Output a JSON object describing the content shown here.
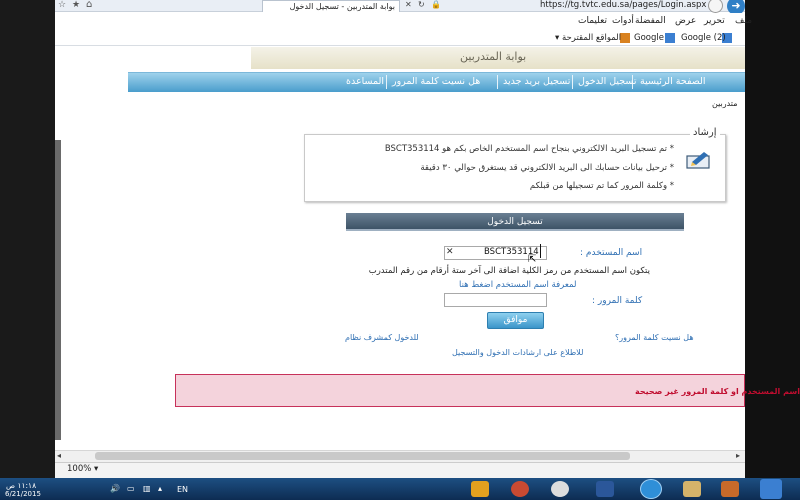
{
  "browser": {
    "tab_title": "بوابة المتدربين - تسجيل الدخول",
    "address": "https://tg.tvtc.edu.sa/pages/Login.aspx",
    "menu": [
      "ملف",
      "تحرير",
      "عرض",
      "المفضلة",
      "أدوات",
      "تعليمات"
    ],
    "favorites": [
      {
        "label": "المواقع المقترحة ▾",
        "icon": "suggested-sites-icon"
      },
      {
        "label": "Google",
        "icon": "google-icon"
      },
      {
        "label": "Google (2)",
        "icon": "google-icon"
      }
    ],
    "zoom": "100% ▾"
  },
  "portal": {
    "banner_title": "بوابة المتدربين",
    "nav": [
      "الصفحة الرئيسية",
      "تسجيل الدخول",
      "تسجيل بريد جديد",
      "هل نسيت كلمة المرور",
      "المساعدة"
    ],
    "breadcrumb": "متدربين"
  },
  "notice": {
    "title": "إرشاد",
    "lines": [
      "* تم تسجيل البريد الالكتروني بنجاح اسم المستخدم الخاص بكم هو BSCT353114",
      "* ترحيل بيانات حسابك الى البريد الالكتروني قد يستغرق حوالي ٣٠ دقيقة",
      "* وكلمة المرور كما تم تسجيلها من قبلكم"
    ]
  },
  "login": {
    "title": "تسجيل الدخول",
    "username_label": "اسم المستخدم :",
    "username_value": "BSCT353114",
    "hint": "يتكون اسم المستخدم من رمز الكلية اضافة الى آخر ستة أرقام من رقم المتدرب",
    "hint_link": "لمعرفة اسم المستخدم اضغط هنا",
    "password_label": "كلمة المرور :",
    "ok_label": "موافق",
    "forgot_link": "هل نسيت كلمة المرور؟",
    "supervisor_link": "للدخول كمشرف نظام",
    "instructions_link": "للاطلاع على ارشادات الدخول والتسجيل",
    "error": "اسم المستخدم او كلمة المرور غير صحيحة"
  },
  "taskbar": {
    "lang": "EN",
    "time": "١١:١٨ ص",
    "date": "6/21/2015"
  }
}
